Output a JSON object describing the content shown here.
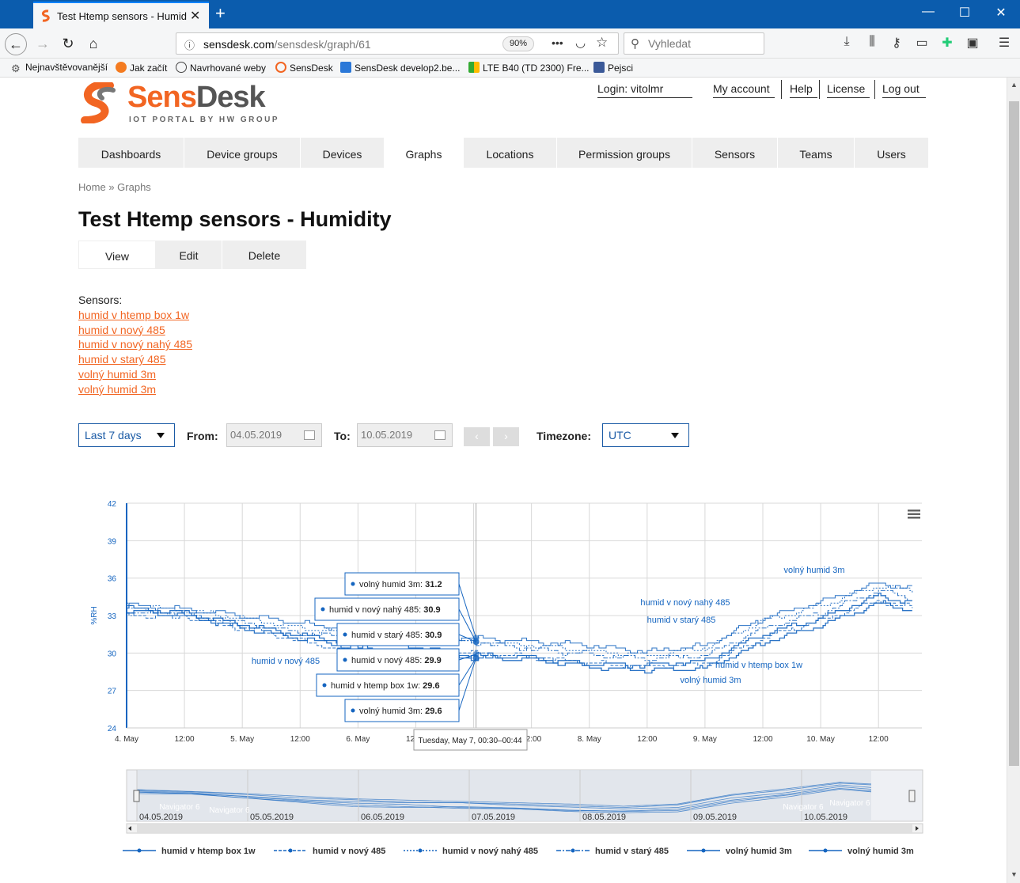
{
  "browser": {
    "tab_title": "Test Htemp sensors - Humidity",
    "url_host": "sensdesk.com",
    "url_path": "/sensdesk/graph/61",
    "zoom": "90%",
    "search_placeholder": "Vyhledat",
    "bookmarks": [
      "Nejnavštěvovanější",
      "Jak začít",
      "Navrhované weby",
      "SensDesk",
      "SensDesk develop2.be...",
      "LTE B40 (TD 2300) Fre...",
      "Pejsci"
    ]
  },
  "header": {
    "brand_a": "Sens",
    "brand_b": "Desk",
    "tagline": "IOT PORTAL BY HW GROUP",
    "login_label": "Login: vitolmr",
    "my_account": "My account",
    "help": "Help",
    "license": "License",
    "logout": "Log out"
  },
  "nav": [
    "Dashboards",
    "Device groups",
    "Devices",
    "Graphs",
    "Locations",
    "Permission groups",
    "Sensors",
    "Teams",
    "Users"
  ],
  "breadcrumb": {
    "home": "Home",
    "sep": "»",
    "current": "Graphs"
  },
  "page_title": "Test Htemp sensors - Humidity",
  "subtabs": [
    "View",
    "Edit",
    "Delete"
  ],
  "sensors": {
    "header": "Sensors:",
    "links": [
      "humid v htemp box 1w",
      "humid v nový 485",
      "humid v nový nahý 485",
      "humid v starý 485",
      "volný humid 3m",
      "volný humid 3m"
    ]
  },
  "controls": {
    "range": "Last 7 days",
    "from_label": "From:",
    "from_value": "04.05.2019",
    "to_label": "To:",
    "to_value": "10.05.2019",
    "prev": "‹",
    "next": "›",
    "timezone_label": "Timezone:",
    "timezone": "UTC"
  },
  "colors": {
    "accent": "#f26522",
    "series": "#1565c0",
    "nav_bg": "#eeeeee"
  },
  "chart_data": {
    "type": "line",
    "ylabel": "%RH",
    "ylim": [
      24,
      42
    ],
    "yticks": [
      24,
      27,
      30,
      33,
      36,
      39,
      42
    ],
    "xlim": [
      "2019-05-04T00:00",
      "2019-05-10T21:00"
    ],
    "xticks": [
      "4. May",
      "12:00",
      "5. May",
      "12:00",
      "6. May",
      "12:00",
      "7. May",
      "12:00",
      "8. May",
      "12:00",
      "9. May",
      "12:00",
      "10. May",
      "12:00"
    ],
    "grid": true,
    "x_hours": [
      0,
      12,
      24,
      36,
      48,
      60,
      72,
      84,
      96,
      108,
      120,
      132,
      144,
      156,
      163
    ],
    "series": [
      {
        "name": "humid v htemp box 1w",
        "values": [
          33.6,
          33.2,
          32.3,
          31.4,
          30.8,
          30.5,
          29.8,
          29.6,
          29.1,
          29.0,
          29.4,
          31.5,
          32.8,
          34.6,
          34.0
        ]
      },
      {
        "name": "humid v nový 485",
        "values": [
          33.0,
          32.9,
          32.0,
          31.0,
          30.0,
          29.8,
          30.0,
          29.7,
          29.2,
          28.9,
          29.1,
          31.2,
          32.6,
          34.2,
          33.6
        ]
      },
      {
        "name": "humid v nový nahý 485",
        "values": [
          33.8,
          33.4,
          32.8,
          32.0,
          31.6,
          31.0,
          30.9,
          30.6,
          30.2,
          29.8,
          30.4,
          32.6,
          33.8,
          35.4,
          35.0
        ]
      },
      {
        "name": "humid v starý 485",
        "values": [
          33.3,
          33.0,
          32.4,
          31.6,
          31.2,
          30.9,
          30.9,
          30.3,
          29.9,
          29.5,
          29.8,
          32.0,
          33.2,
          35.0,
          34.4
        ]
      },
      {
        "name": "volný humid 3m",
        "values": [
          33.4,
          33.0,
          32.0,
          31.2,
          30.4,
          30.0,
          29.6,
          29.5,
          28.9,
          28.6,
          28.8,
          30.8,
          32.2,
          34.0,
          33.4
        ]
      },
      {
        "name": "volný humid 3m",
        "values": [
          33.9,
          33.5,
          33.0,
          32.4,
          31.8,
          31.5,
          31.2,
          30.9,
          30.6,
          30.1,
          30.6,
          32.8,
          34.1,
          35.6,
          35.2
        ]
      }
    ],
    "series_labels": [
      {
        "text": "volný humid 3m"
      },
      {
        "text": "humid v nový nahý 485"
      },
      {
        "text": "humid v starý 485"
      },
      {
        "text": "humid v nový 485"
      },
      {
        "text": "humid v htemp box 1w"
      },
      {
        "text": "volný humid 3m"
      }
    ],
    "tooltip": {
      "header": "Tuesday, May 7, 00:30–00:44",
      "rows": [
        {
          "label": "volný humid 3m",
          "value": "31.2"
        },
        {
          "label": "humid v nový nahý 485",
          "value": "30.9"
        },
        {
          "label": "humid v starý 485",
          "value": "30.9"
        },
        {
          "label": "humid v nový 485",
          "value": "29.9"
        },
        {
          "label": "humid v htemp box 1w",
          "value": "29.6"
        },
        {
          "label": "volný humid 3m",
          "value": "29.6"
        }
      ]
    },
    "navigator_dates": [
      "04.05.2019",
      "05.05.2019",
      "06.05.2019",
      "07.05.2019",
      "08.05.2019",
      "09.05.2019",
      "10.05.2019"
    ],
    "navigator_label": "Navigator 6",
    "legend": [
      "humid v htemp box 1w",
      "humid v nový 485",
      "humid v nový nahý 485",
      "humid v starý 485",
      "volný humid 3m",
      "volný humid 3m"
    ]
  }
}
